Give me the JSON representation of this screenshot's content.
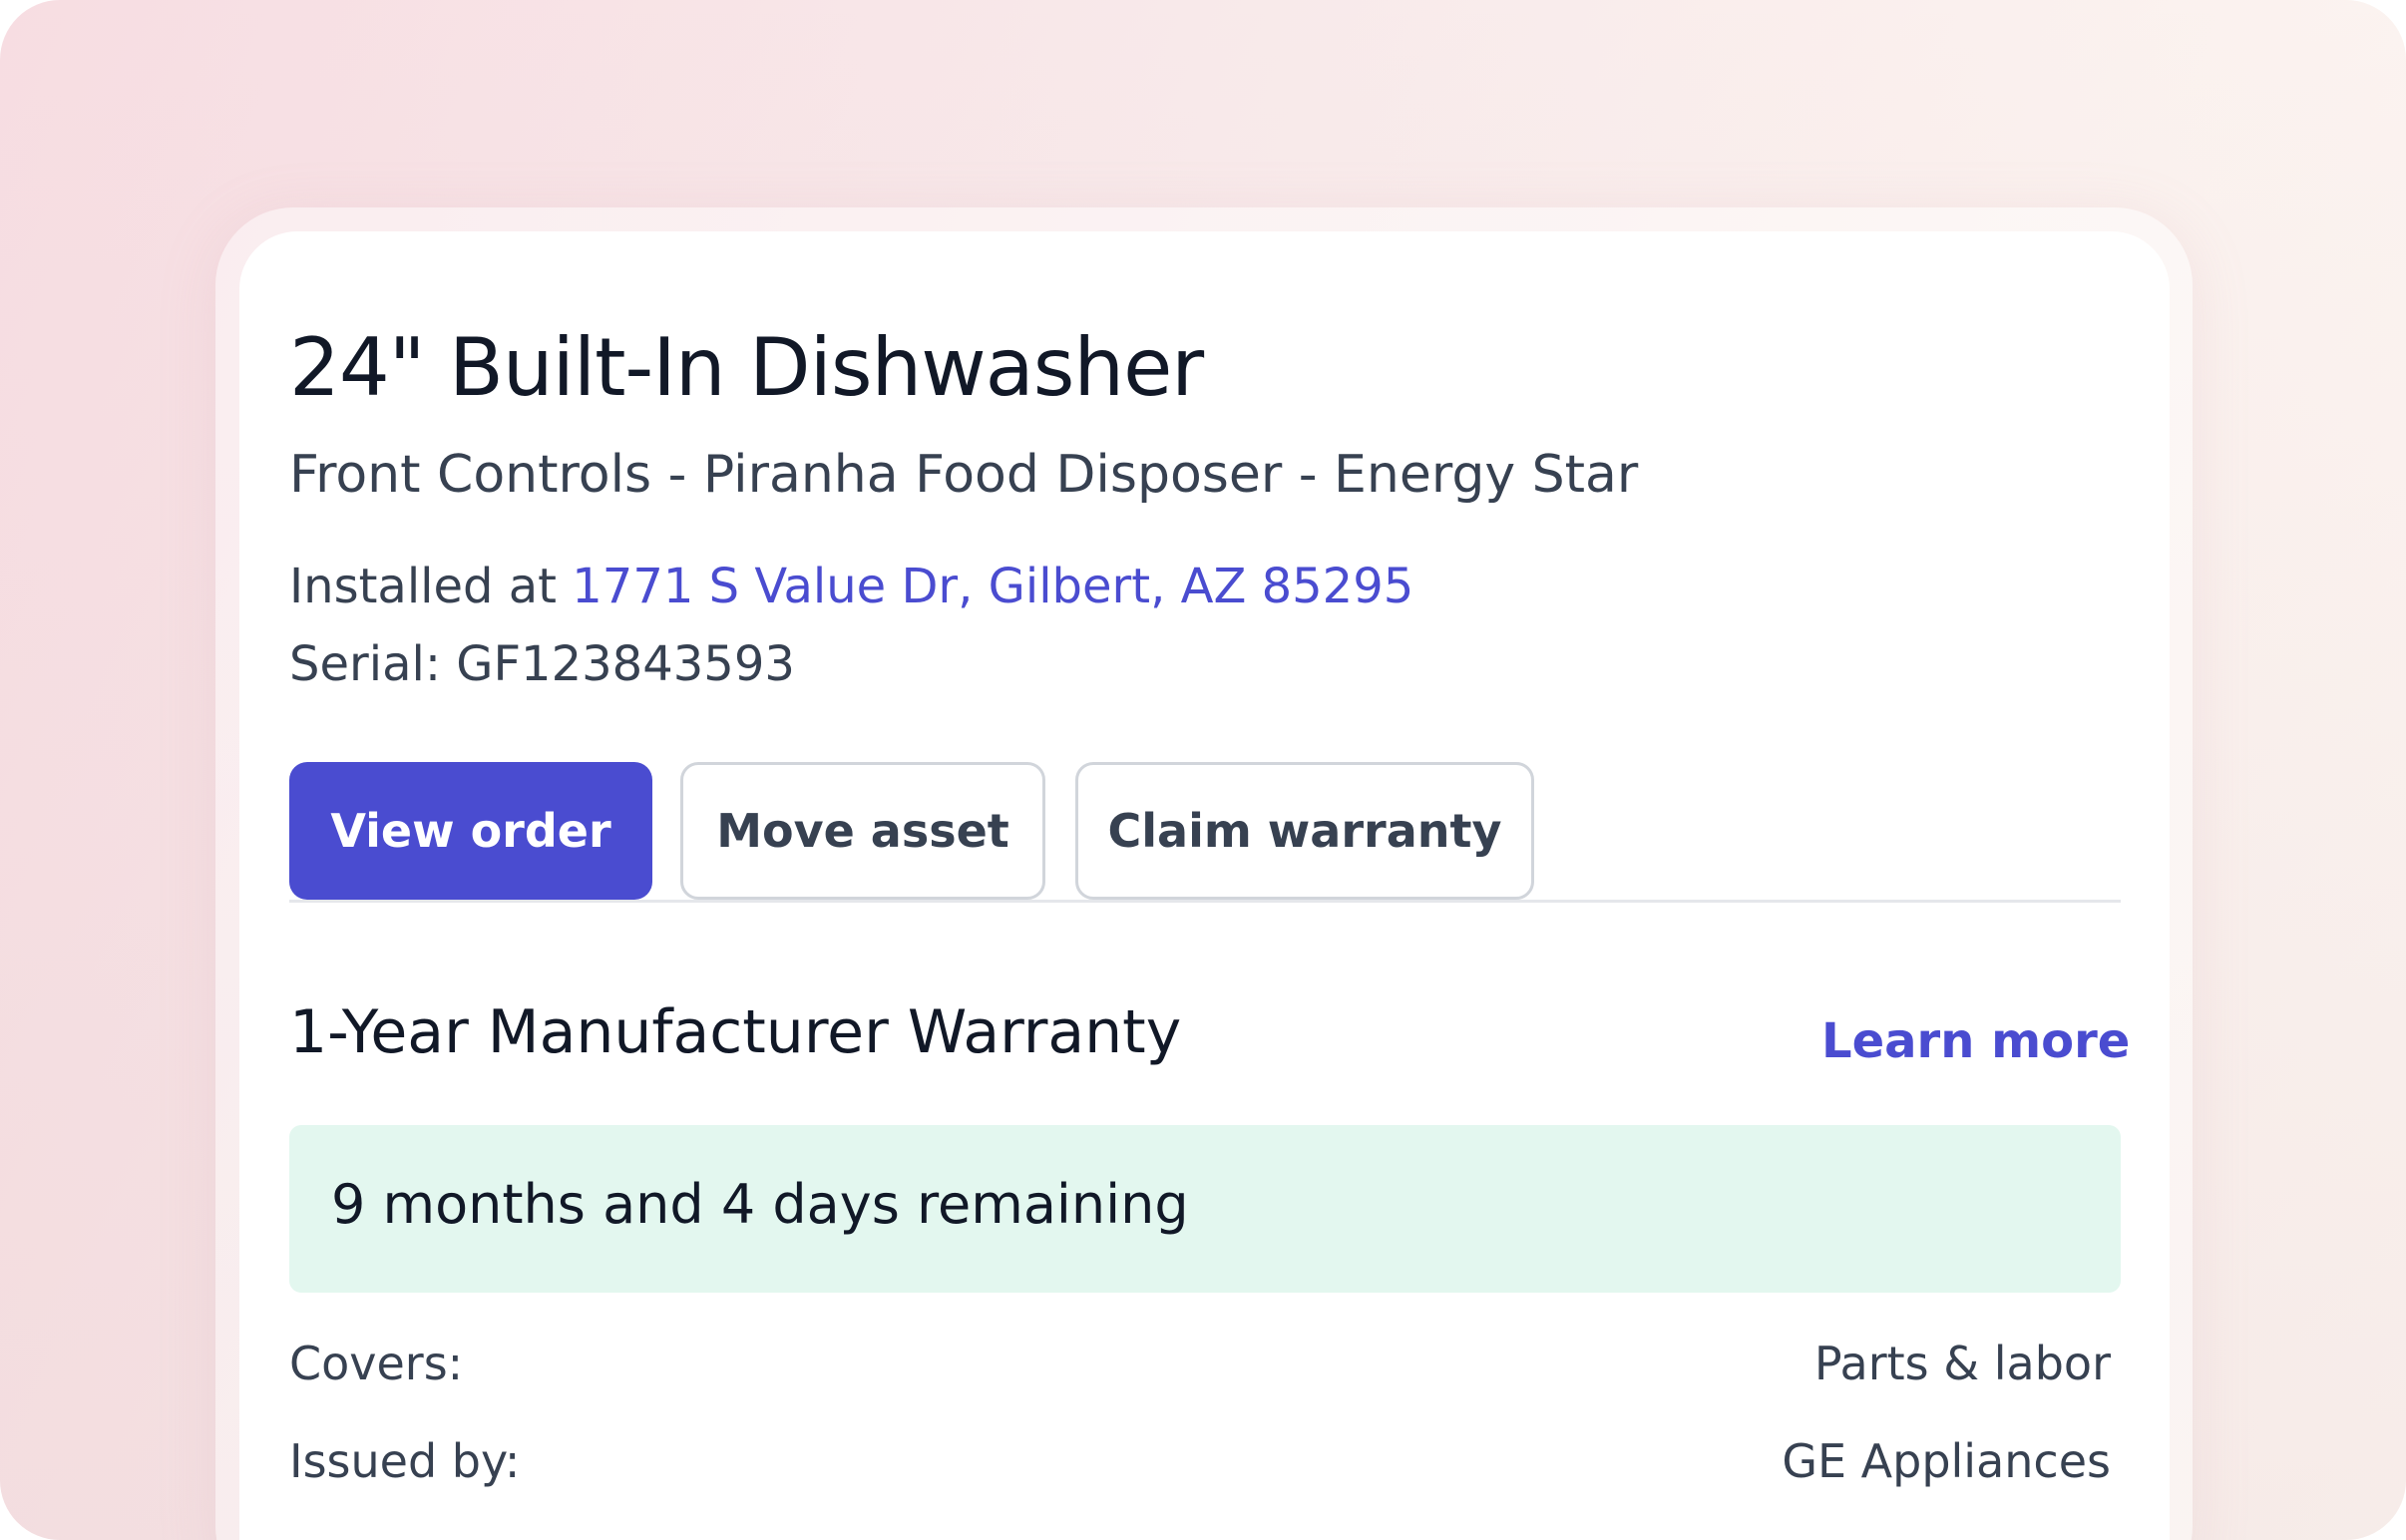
{
  "product": {
    "title": "24\" Built-In Dishwasher",
    "subtitle": "Front Controls - Piranha Food Disposer - Energy Star",
    "installed_prefix": "Installed at ",
    "address": "1771 S Value Dr, Gilbert, AZ 85295",
    "serial_label": "Serial: ",
    "serial": "GF123843593"
  },
  "actions": {
    "view_order": "View order",
    "move_asset": "Move asset",
    "claim_warranty": "Claim warranty"
  },
  "warranty": {
    "title": "1-Year Manufacturer Warranty",
    "learn_more": "Learn more",
    "remaining": "9 months and 4 days remaining",
    "rows": [
      {
        "label": "Covers:",
        "value": "Parts & labor"
      },
      {
        "label": "Issued by:",
        "value": "GE Appliances"
      }
    ]
  },
  "colors": {
    "accent": "#4a4cd0",
    "success_bg": "#e3f7ef",
    "text_primary": "#111827",
    "text_secondary": "#374151"
  }
}
